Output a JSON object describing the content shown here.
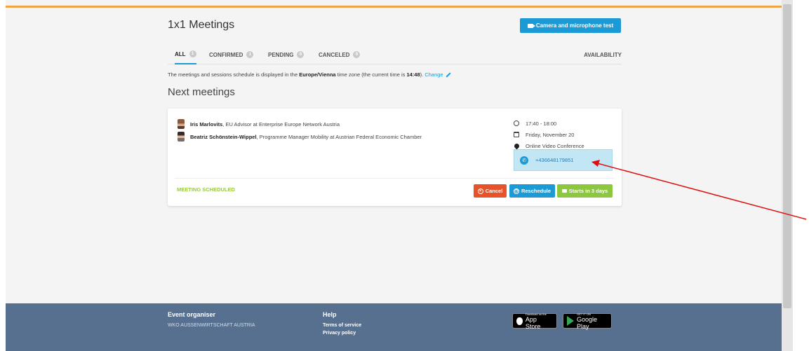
{
  "header": {
    "title": "1x1 Meetings",
    "camera_test_label": "Camera and microphone test"
  },
  "tabs": [
    {
      "label": "ALL",
      "count": "1",
      "active": true
    },
    {
      "label": "CONFIRMED",
      "count": "1",
      "active": false
    },
    {
      "label": "PENDING",
      "count": "0",
      "active": false
    },
    {
      "label": "CANCELED",
      "count": "0",
      "active": false
    }
  ],
  "availability_label": "AVAILABILITY",
  "timezone_note": {
    "prefix": "The meetings and sessions schedule is displayed in the ",
    "timezone": "Europe/Vienna",
    "middle": " time zone (the current time is ",
    "current_time": "14:48",
    "suffix": "). ",
    "change_label": "Change"
  },
  "section_title": "Next meetings",
  "meeting": {
    "participants": [
      {
        "name": "Iris Marlovits",
        "role": ", EU Advisor at Enterprise Europe Network Austria"
      },
      {
        "name": "Beatriz Schönstein-Wippel",
        "role": ", Programme Manager Mobility at Austrian Federal Economic Chamber"
      }
    ],
    "time": "17:40 - 18:00",
    "date": "Friday, November 20",
    "location": "Online Video Conference",
    "phone": "+436648179851",
    "status": "MEETING SCHEDULED",
    "cancel_label": "Cancel",
    "reschedule_label": "Reschedule",
    "starts_label": "Starts in 3 days"
  },
  "footer": {
    "organiser_heading": "Event organiser",
    "organiser_name": "WKO AUSSENWIRTSCHAFT AUSTRIA",
    "help_heading": "Help",
    "terms_label": "Terms of service",
    "privacy_label": "Privacy policy",
    "app_store_small": "Download on the",
    "app_store_big": "App Store",
    "google_play_small": "GET IT ON",
    "google_play_big": "Google Play"
  },
  "colors": {
    "accent_blue": "#1c9ad6",
    "top_accent": "#f0a447",
    "cancel_red": "#e8522a",
    "success_green": "#8dc63f",
    "footer_bg": "#587090",
    "annotation_arrow": "#e01010"
  }
}
